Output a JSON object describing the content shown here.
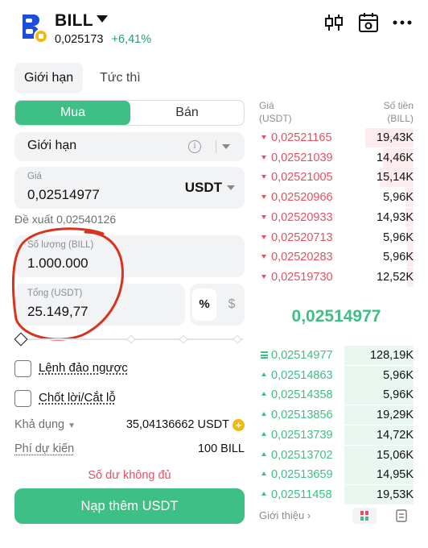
{
  "header": {
    "symbol": "BILL",
    "price": "0,025173",
    "change": "+6,41%",
    "icons": [
      "candlestick-icon",
      "calendar-icon",
      "more-icon"
    ]
  },
  "order_tabs": {
    "limit": "Giới hạn",
    "market": "Tức thì"
  },
  "side": {
    "buy": "Mua",
    "sell": "Bán"
  },
  "order_type": {
    "value": "Giới hạn"
  },
  "price_field": {
    "label": "Giá",
    "value": "0,02514977",
    "unit": "USDT"
  },
  "suggestion": "Đề xuất 0,02540126",
  "quantity_field": {
    "label": "Số lượng (BILL)",
    "value": "1.000.000"
  },
  "total_field": {
    "label": "Tổng (USDT)",
    "value": "25.149,77"
  },
  "unit_toggle": {
    "percent": "%",
    "dollar": "$"
  },
  "slider": {
    "value_fraction": 0
  },
  "checkboxes": {
    "reverse_order": "Lệnh đảo ngược",
    "tp_sl": "Chốt lời/Cắt lỗ"
  },
  "available": {
    "label": "Khả dụng",
    "value": "35,04136662 USDT"
  },
  "fee": {
    "label": "Phí dự kiến",
    "value": "100 BILL"
  },
  "warning": "Số dư không đủ",
  "deposit_button": "Nạp thêm USDT",
  "orderbook": {
    "price_header": [
      "Giá",
      "(USDT)"
    ],
    "amount_header": [
      "Số tiền",
      "(BILL)"
    ],
    "asks": [
      {
        "price": "0,02521165",
        "amount": "19,43K",
        "depth": 0.31
      },
      {
        "price": "0,02521039",
        "amount": "14,46K",
        "depth": 0.2
      },
      {
        "price": "0,02521005",
        "amount": "15,14K",
        "depth": 0.22
      },
      {
        "price": "0,02520966",
        "amount": "5,96K",
        "depth": 0.05
      },
      {
        "price": "0,02520933",
        "amount": "14,93K",
        "depth": 0.05
      },
      {
        "price": "0,02520713",
        "amount": "5,96K",
        "depth": 0.04
      },
      {
        "price": "0,02520283",
        "amount": "5,96K",
        "depth": 0.04
      },
      {
        "price": "0,02519730",
        "amount": "12,52K",
        "depth": 0.04
      }
    ],
    "mid_price": "0,02514977",
    "bids": [
      {
        "price": "0,02514977",
        "amount": "128,19K",
        "depth": 0.45
      },
      {
        "price": "0,02514863",
        "amount": "5,96K",
        "depth": 0.45
      },
      {
        "price": "0,02514358",
        "amount": "5,96K",
        "depth": 0.45
      },
      {
        "price": "0,02513856",
        "amount": "19,29K",
        "depth": 0.45
      },
      {
        "price": "0,02513739",
        "amount": "14,72K",
        "depth": 0.45
      },
      {
        "price": "0,02513702",
        "amount": "15,06K",
        "depth": 0.45
      },
      {
        "price": "0,02513659",
        "amount": "14,95K",
        "depth": 0.45
      },
      {
        "price": "0,02511458",
        "amount": "19,53K",
        "depth": 0.45
      }
    ],
    "footer_link": "Giới thiệu ›"
  },
  "colors": {
    "green": "#3dbf85",
    "red": "#e05262",
    "ask_bg": "#fdecee",
    "bid_bg": "#e9f7f0",
    "annotation": "#d9321f"
  }
}
